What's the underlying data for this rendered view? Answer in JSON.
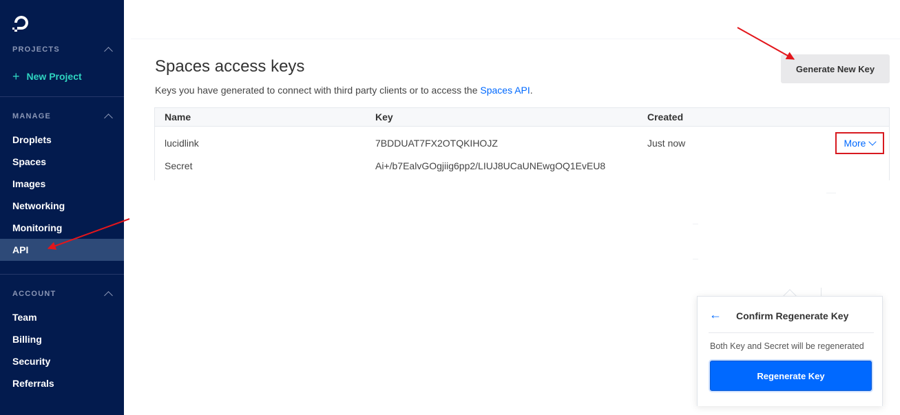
{
  "sidebar": {
    "sections": {
      "projects": "PROJECTS",
      "manage": "MANAGE",
      "account": "ACCOUNT"
    },
    "new_project": "New Project",
    "manage_items": [
      "Droplets",
      "Spaces",
      "Images",
      "Networking",
      "Monitoring",
      "API"
    ],
    "account_items": [
      "Team",
      "Billing",
      "Security",
      "Referrals"
    ],
    "active": "API",
    "colors": {
      "bg": "#031b4e",
      "accent": "#2fd4c0",
      "active_bg": "#2e4a78"
    }
  },
  "main": {
    "title": "Spaces access keys",
    "subtitle_text": "Keys you have generated to connect with third party clients or to access the ",
    "subtitle_link": "Spaces API",
    "subtitle_end": ".",
    "generate_button": "Generate New Key",
    "table": {
      "headers": {
        "name": "Name",
        "key": "Key",
        "created": "Created"
      },
      "row": {
        "name": "lucidlink",
        "key": "7BDDUAT7FX2OTQKIHOJZ",
        "created": "Just now",
        "more": "More",
        "secret_label": "Secret",
        "secret_value": "Ai+/b7EalvGOgjiig6pp2/LIUJ8UCaUNEwgOQ1EvEU8"
      }
    }
  },
  "popover": {
    "back_glyph": "←",
    "title": "Confirm Regenerate Key",
    "message": "Both Key and Secret will be regenerated",
    "confirm_button": "Regenerate Key",
    "colors": {
      "primary": "#0069ff"
    }
  },
  "annotations": {
    "arrow_color": "#e3161b"
  }
}
